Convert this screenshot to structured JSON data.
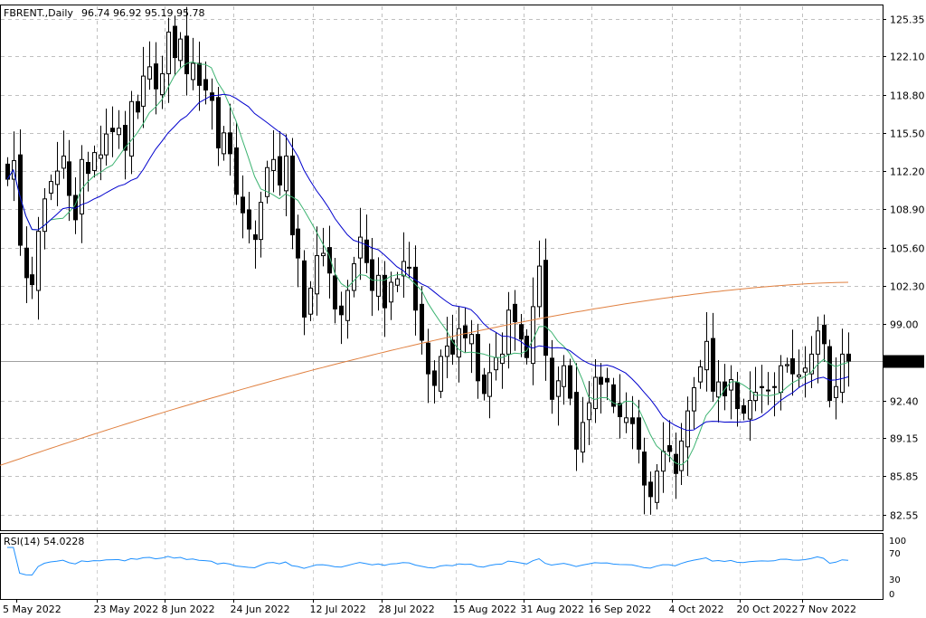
{
  "chart_data": {
    "type": "candlestick",
    "title": "",
    "header": {
      "symbol": "FBRENT.,Daily",
      "ohlc": "96.74 96.92 95.19 95.78"
    },
    "current_price": "95.78",
    "price_axis": {
      "ticks": [
        "125.35",
        "122.10",
        "118.80",
        "115.50",
        "112.20",
        "108.90",
        "105.60",
        "102.30",
        "99.00",
        "95.70",
        "92.40",
        "89.15",
        "85.85",
        "82.55"
      ],
      "ylim": [
        81.2,
        126.5
      ]
    },
    "date_axis": {
      "ticks": [
        "5 May 2022",
        "23 May 2022",
        "8 Jun 2022",
        "24 Jun 2022",
        "12 Jul 2022",
        "28 Jul 2022",
        "15 Aug 2022",
        "31 Aug 2022",
        "16 Sep 2022",
        "4 Oct 2022",
        "20 Oct 2022",
        "7 Nov 2022"
      ]
    },
    "closes": [
      111.5,
      113.1,
      105.8,
      103.0,
      102.4,
      107.0,
      109.8,
      111.3,
      112.2,
      113.5,
      110.1,
      108.0,
      113.2,
      112.0,
      113.8,
      113.6,
      115.4,
      115.6,
      115.9,
      114.0,
      118.2,
      117.3,
      120.4,
      121.2,
      119.3,
      120.6,
      124.2,
      122.0,
      123.6,
      120.6,
      121.5,
      119.6,
      119.2,
      118.3,
      114.2,
      115.5,
      113.7,
      110.2,
      108.6,
      107.2,
      106.3,
      109.5,
      112.5,
      113.2,
      111.0,
      113.5,
      106.7,
      104.7,
      99.6,
      102.1,
      104.9,
      105.1,
      103.4,
      100.3,
      99.8,
      101.9,
      104.2,
      106.5,
      104.3,
      101.9,
      103.2,
      100.4,
      102.6,
      102.9,
      104.4,
      103.9,
      100.2,
      97.6,
      94.7,
      93.7,
      96.2,
      97.1,
      96.4,
      98.6,
      97.8,
      98.1,
      94.1,
      93.0,
      94.8,
      96.1,
      96.4,
      100.2,
      99.2,
      97.7,
      96.1,
      100.5,
      104.0,
      96.3,
      92.5,
      94.1,
      95.4,
      92.6,
      88.2,
      90.5,
      92.2,
      94.4,
      93.8,
      94.0,
      91.9,
      91.0,
      90.9,
      90.4,
      88.2,
      85.1,
      84.1,
      86.3,
      88.0,
      88.0,
      86.1,
      88.9,
      91.5,
      93.5,
      95.3,
      97.5,
      93.2,
      94.0,
      92.8,
      94.2,
      91.7,
      91.3,
      92.4,
      93.1,
      93.5,
      93.3,
      93.6,
      95.4,
      95.5,
      94.7,
      94.6,
      95.2,
      96.4,
      98.4,
      97.3,
      92.4,
      93.6,
      96.4,
      95.8
    ]
  }
}
